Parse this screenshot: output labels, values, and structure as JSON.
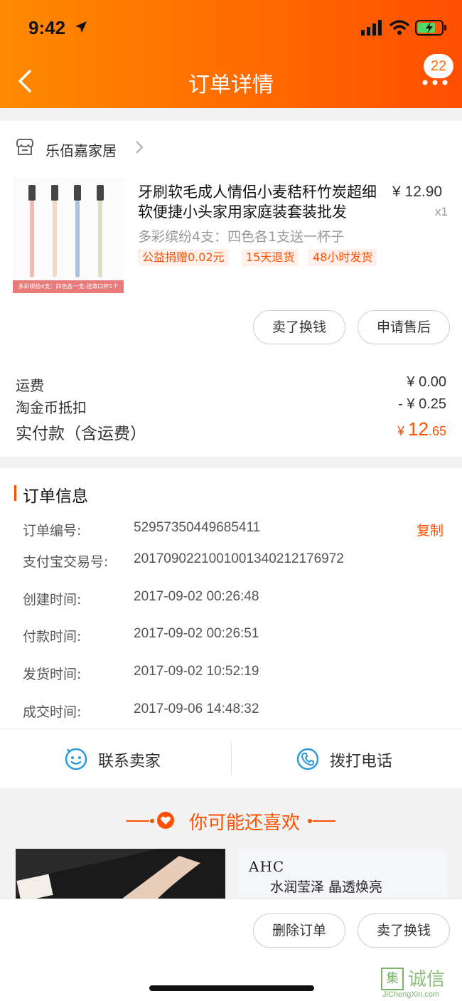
{
  "status_bar": {
    "time": "9:42"
  },
  "header": {
    "title": "订单详情",
    "badge_count": "22"
  },
  "shop": {
    "name": "乐佰嘉家居"
  },
  "product": {
    "title": "牙刷软毛成人情侣小麦秸秆竹炭超细软便捷小头家用家庭装套装批发",
    "price": "¥ 12.90",
    "quantity": "x1",
    "sku": "多彩缤纷4支：四色各1支送一杯子",
    "image_caption": "多彩缤纷4支：四色各一支-送漱口杯1个",
    "tags": [
      "公益捐赠0.02元",
      "15天退货",
      "48小时发货"
    ],
    "actions": [
      "卖了换钱",
      "申请售后"
    ]
  },
  "fees": {
    "shipping_label": "运费",
    "shipping_value": "¥ 0.00",
    "coin_label": "淘金币抵扣",
    "coin_value": "- ¥ 0.25",
    "paid_label": "实付款（含运费）",
    "paid_currency": "¥ ",
    "paid_int": "12",
    "paid_dec": ".65"
  },
  "order_info": {
    "title": "订单信息",
    "copy_label": "复制",
    "rows": [
      {
        "label": "订单编号:",
        "value": "52957350449685411"
      },
      {
        "label": "支付宝交易号:",
        "value": "2017090221001001340212176972"
      },
      {
        "label": "创建时间:",
        "value": "2017-09-02 00:26:48"
      },
      {
        "label": "付款时间:",
        "value": "2017-09-02 00:26:51"
      },
      {
        "label": "发货时间:",
        "value": "2017-09-02 10:52:19"
      },
      {
        "label": "成交时间:",
        "value": "2017-09-06 14:48:32"
      }
    ]
  },
  "contact": {
    "seller": "联系卖家",
    "phone": "拨打电话"
  },
  "recommend": {
    "title": "你可能还喜欢",
    "card2_brand": "AHC",
    "card2_slogan": "水润莹泽  晶透焕亮"
  },
  "bottom_bar": {
    "delete": "删除订单",
    "sell": "卖了换钱"
  },
  "watermark": {
    "char": "集",
    "text": "诚信",
    "sub": "JiChengXin.com"
  },
  "colors": {
    "accent": "#ff5000",
    "header_start": "#ff8a00",
    "header_end": "#ff4f00"
  }
}
